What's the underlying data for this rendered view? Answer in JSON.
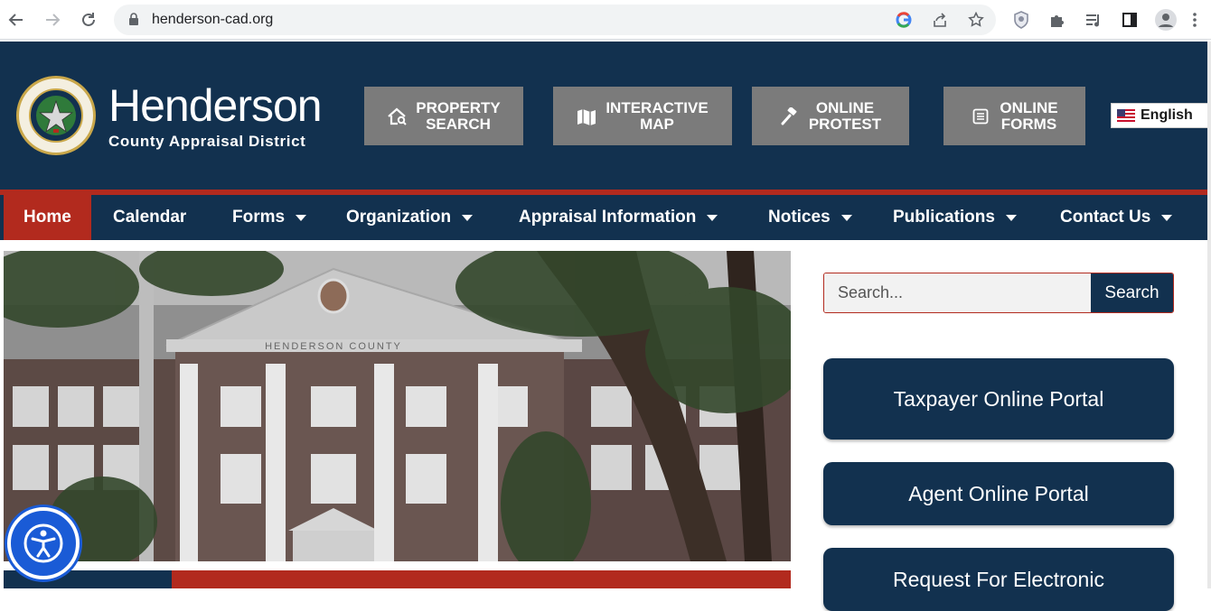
{
  "browser": {
    "url": "henderson-cad.org",
    "icons": [
      "back-icon",
      "forward-icon",
      "reload-icon",
      "lock-icon",
      "google-icon",
      "share-icon",
      "bookmark-star-icon",
      "shield-extension-icon",
      "extensions-puzzle-icon",
      "media-queue-icon",
      "side-panel-icon",
      "profile-avatar-icon",
      "kebab-menu-icon"
    ]
  },
  "header": {
    "logo_name": "Henderson",
    "logo_sub": "County Appraisal District",
    "seal_text_top": "TEXAS",
    "seal_text_bottom": "APPRAISAL DISTRICT",
    "buttons": [
      {
        "label_line1": "PROPERTY",
        "label_line2": "SEARCH",
        "icon": "house-search-icon"
      },
      {
        "label_line1": "INTERACTIVE",
        "label_line2": "MAP",
        "icon": "map-icon"
      },
      {
        "label_line1": "ONLINE",
        "label_line2": "PROTEST",
        "icon": "gavel-icon"
      },
      {
        "label_line1": "ONLINE",
        "label_line2": "FORMS",
        "icon": "form-icon"
      }
    ],
    "language": "English"
  },
  "nav": {
    "items": [
      {
        "label": "Home",
        "active": true
      },
      {
        "label": "Calendar"
      },
      {
        "label": "Forms",
        "dropdown": true
      },
      {
        "label": "Organization",
        "dropdown": true
      },
      {
        "label": "Appraisal Information",
        "dropdown": true
      },
      {
        "label": "Notices",
        "dropdown": true
      },
      {
        "label": "Publications",
        "dropdown": true
      },
      {
        "label": "Contact Us",
        "dropdown": true
      }
    ]
  },
  "hero": {
    "building_inscription": "HENDERSON COUNTY"
  },
  "sidebar": {
    "search_placeholder": "Search...",
    "search_button": "Search",
    "portals": [
      {
        "label": "Taxpayer Online Portal"
      },
      {
        "label": "Agent Online Portal"
      },
      {
        "label": "Request For Electronic"
      }
    ]
  },
  "colors": {
    "navy": "#12314f",
    "red": "#b22a1e",
    "button_gray": "#7b7b7b",
    "accessibility_blue": "#1a5bd6"
  }
}
